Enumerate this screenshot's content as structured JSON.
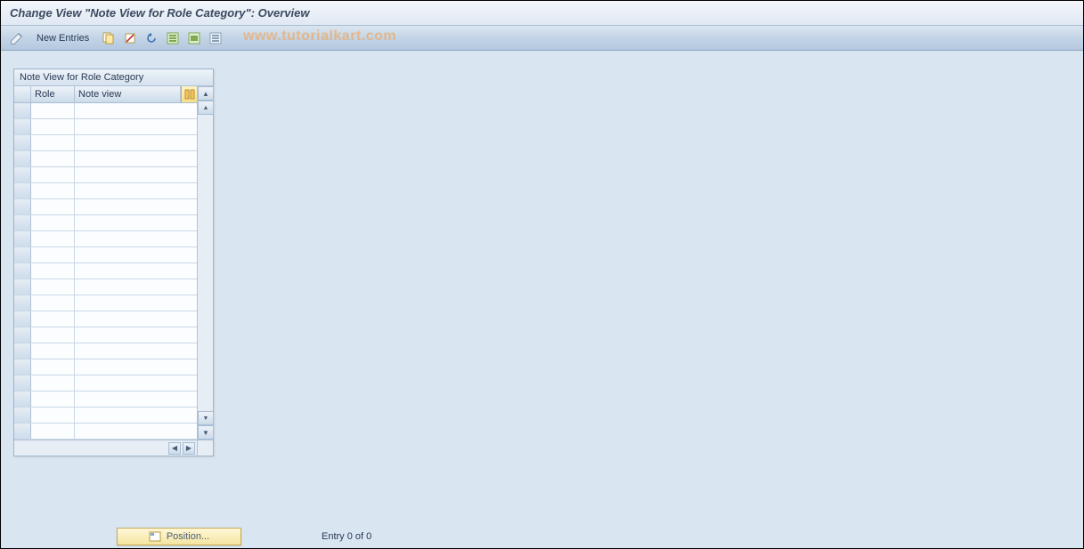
{
  "header": {
    "title": "Change View \"Note View for Role Category\": Overview"
  },
  "toolbar": {
    "new_entries_label": "New Entries"
  },
  "watermark": "www.tutorialkart.com",
  "panel": {
    "title": "Note View for Role Category",
    "columns": {
      "role": "Role",
      "note": "Note view"
    },
    "row_count": 21
  },
  "footer": {
    "position_label": "Position...",
    "entry_text": "Entry 0 of 0"
  }
}
